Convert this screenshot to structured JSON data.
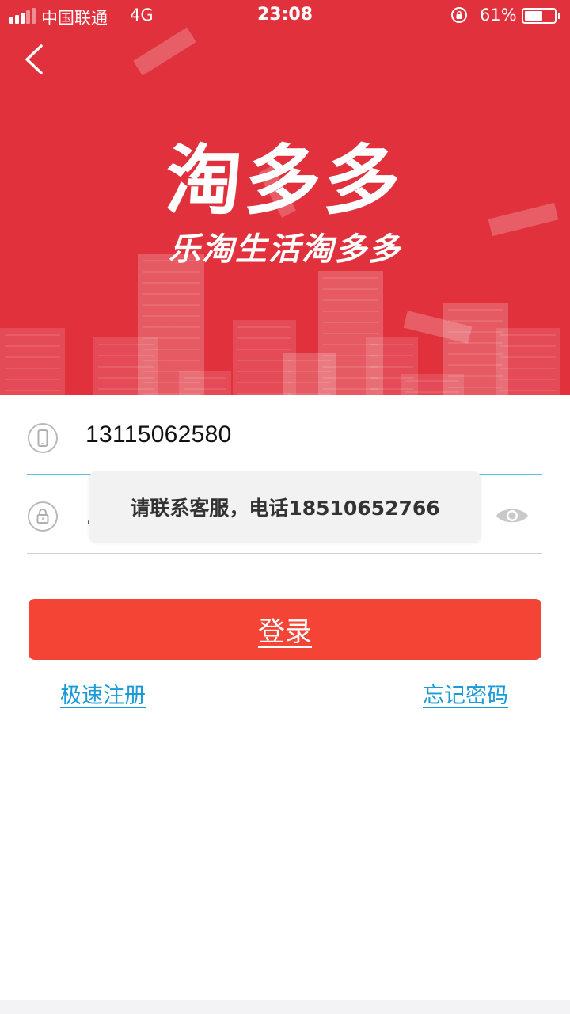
{
  "status_bar": {
    "carrier": "中国联通",
    "network": "4G",
    "time": "23:08",
    "battery_percent_label": "61%",
    "battery_level": 0.61
  },
  "header": {
    "back_icon": "chevron-left-icon",
    "app_title": "淘多多",
    "slogan": "乐淘生活淘多多",
    "background_color": "#e0313d"
  },
  "form": {
    "phone_icon": "mobile-phone-icon",
    "phone_value": "13115062580",
    "password_icon": "lock-icon",
    "password_mask": "..",
    "visibility_icon": "eye-icon"
  },
  "toast": {
    "message": "请联系客服，电话18510652766"
  },
  "actions": {
    "login_label": "登录",
    "login_color": "#f34436",
    "register_label": "极速注册",
    "forgot_label": "忘记密码",
    "link_color": "#1a9ad6"
  }
}
